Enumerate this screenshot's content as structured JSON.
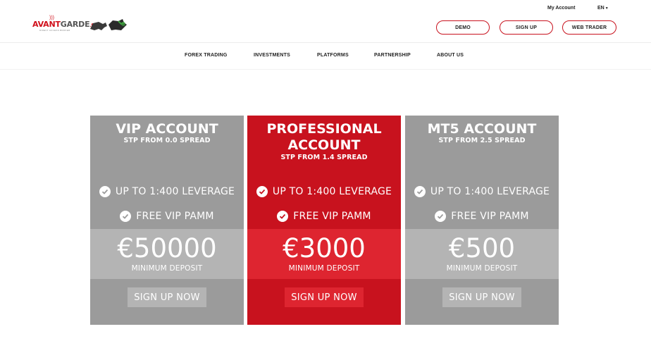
{
  "brand": {
    "logo_text_a": "AVANT",
    "logo_text_b": "GARDE",
    "logo_text_c": ".fx",
    "logo_tagline": "DIRECT ACCESS BROKER",
    "accent": "#c8121e",
    "grey": "#9b9b9b"
  },
  "top": {
    "my_account": "My Account",
    "language": "EN"
  },
  "header_buttons": {
    "demo": "DEMO",
    "signup": "SIGN UP",
    "web_trader": "WEB TRADER"
  },
  "nav": [
    {
      "label": "FOREX TRADING"
    },
    {
      "label": "INVESTMENTS"
    },
    {
      "label": "PLATFORMS"
    },
    {
      "label": "PARTNERSHIP"
    },
    {
      "label": "ABOUT US"
    }
  ],
  "cards": [
    {
      "title": "VIP ACCOUNT",
      "subtitle": "STP FROM 0.0 SPREAD",
      "features": [
        "UP TO 1:400 LEVERAGE",
        "FREE VIP PAMM"
      ],
      "price": "€50000",
      "min_label": "MINIMUM DEPOSIT",
      "cta": "SIGN UP NOW"
    },
    {
      "title_line1": "PROFESSIONAL",
      "title_line2": "ACCOUNT",
      "subtitle": "STP FROM 1.4 SPREAD",
      "features": [
        "UP TO 1:400 LEVERAGE",
        "FREE VIP PAMM"
      ],
      "price": "€3000",
      "min_label": "MINIMUM DEPOSIT",
      "cta": "SIGN UP NOW"
    },
    {
      "title": "MT5 ACCOUNT",
      "subtitle": "STP FROM 2.5 SPREAD",
      "features": [
        "UP TO 1:400 LEVERAGE",
        "FREE VIP PAMM"
      ],
      "price": "€500",
      "min_label": "MINIMUM DEPOSIT",
      "cta": "SIGN UP NOW"
    }
  ]
}
